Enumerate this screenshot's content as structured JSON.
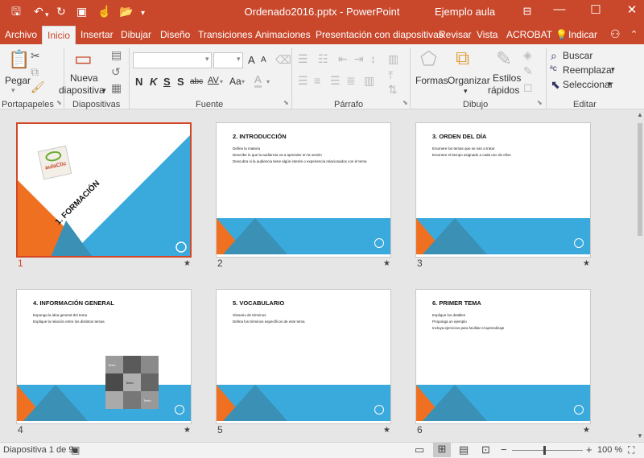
{
  "window": {
    "title": "Ordenado2016.pptx  -  PowerPoint",
    "user": "Ejemplo aula",
    "colors": {
      "accent": "#c9482c",
      "slide_blue": "#3aa9dc",
      "slide_orange": "#f07021"
    }
  },
  "quick_access": [
    "save-icon",
    "undo-icon",
    "redo-icon",
    "presenter-icon",
    "touch-icon",
    "folder-icon",
    "customize-icon"
  ],
  "tabs": [
    "Archivo",
    "Inicio",
    "Insertar",
    "Dibujar",
    "Diseño",
    "Transiciones",
    "Animaciones",
    "Presentación con diapositivas",
    "Revisar",
    "Vista",
    "ACROBAT"
  ],
  "tell_me": "Indicar",
  "ribbon": {
    "clipboard": {
      "paste": "Pegar",
      "group": "Portapapeles"
    },
    "slides": {
      "new_line1": "Nueva",
      "new_line2": "diapositiva",
      "group": "Diapositivas"
    },
    "font": {
      "group": "Fuente",
      "size_up": "A",
      "size_down": "A",
      "bold": "N",
      "italic": "K",
      "underline": "S",
      "strike": "S",
      "shadow": "abc",
      "spacing": "AV",
      "case": "Aa",
      "color": "A"
    },
    "paragraph": {
      "group": "Párrafo"
    },
    "drawing": {
      "shapes": "Formas",
      "arrange": "Organizar",
      "styles_line1": "Estilos",
      "styles_line2": "rápidos",
      "group": "Dibujo"
    },
    "editing": {
      "find": "Buscar",
      "replace": "Reemplazar",
      "select": "Seleccionar",
      "group": "Editar"
    }
  },
  "slides": [
    {
      "number": "1",
      "title": "1. FORMACIÓN",
      "subtitle": "AULACLIC",
      "logo_text": "aulaClic",
      "body": []
    },
    {
      "number": "2",
      "title": "2. INTRODUCCIÓN",
      "body": [
        "Define la materia",
        "Describe lo que la audiencia va a aprender en la sesión",
        "Descubra si la audiencia tiene algún interés o experiencia relacionados con el tema"
      ]
    },
    {
      "number": "3",
      "title": "3. ORDEN DEL DÍA",
      "body": [
        "Enumere los temas que se van a tratar",
        "Enumere el tiempo asignado a cada uno de ellos"
      ]
    },
    {
      "number": "4",
      "title": "4. INFORMACIÓN GENERAL",
      "body": [
        "Exponga la idea general del tema",
        "Explique la relación entre los distintos temas"
      ],
      "puzzle_label": "Texto"
    },
    {
      "number": "5",
      "title": "5. VOCABULARIO",
      "body": [
        "Glosario de términos",
        "Defina los términos específicos de este tema"
      ]
    },
    {
      "number": "6",
      "title": "6. PRIMER TEMA",
      "body": [
        "Explique los detalles",
        "Proponga un ejemplo",
        "Incluya ejercicios para facilitar el aprendizaje"
      ]
    }
  ],
  "status": {
    "slide_info": "Diapositiva 1 de 9",
    "zoom": "100 %"
  }
}
